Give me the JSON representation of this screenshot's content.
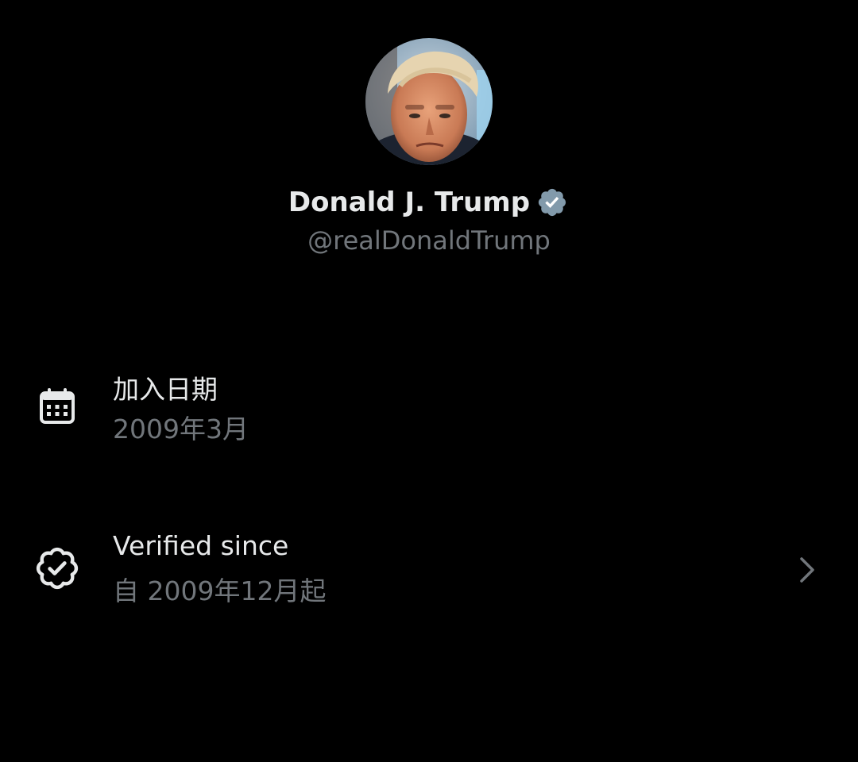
{
  "profile": {
    "display_name": "Donald J. Trump",
    "handle": "@realDonaldTrump",
    "verified_badge_icon": "verified-badge-icon",
    "badge_color": "#829aab"
  },
  "joined": {
    "icon": "calendar-icon",
    "title": "加入日期",
    "value": "2009年3月"
  },
  "verified": {
    "icon": "verified-seal-icon",
    "title": "Verified since",
    "value": "自 2009年12月起",
    "action_icon": "chevron-right-icon"
  },
  "colors": {
    "background": "#000000",
    "primary_text": "#e7e9ea",
    "secondary_text": "#71767b"
  }
}
